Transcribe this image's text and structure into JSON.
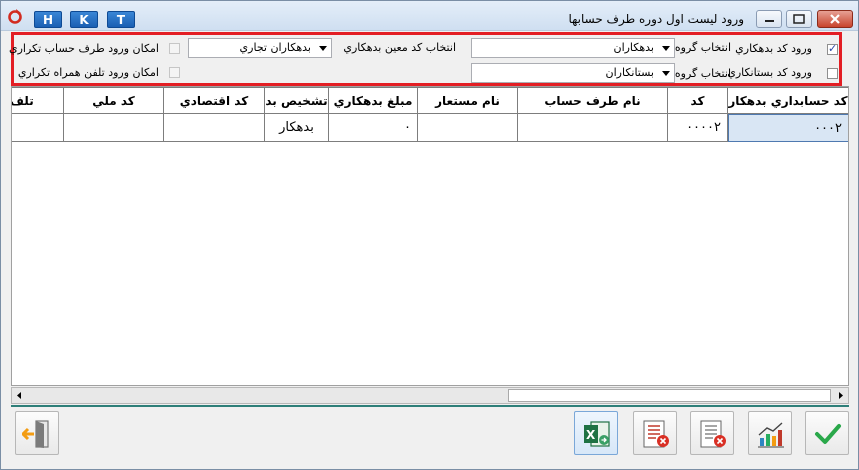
{
  "window": {
    "title": "ورود ليست اول دوره طرف حسابها",
    "hkt": [
      "H",
      "K",
      "T"
    ]
  },
  "filters": {
    "debtor_code_checkbox_label": "ورود کد بدهکاري",
    "debtor_code_checked": true,
    "creditor_code_checkbox_label": "ورود کد بستانکاري",
    "creditor_code_checked": false,
    "group_label_1": "انتخاب گروه",
    "group_value_1": "بدهکاران",
    "group_label_2": "انتخاب گروه",
    "group_value_2": "بستانکاران",
    "specific_code_label": "انتخاب کد معين بدهکاري",
    "specific_code_value": "بدهکاران تجاري",
    "duplicate_account_label": "امکان ورود طرف حساب تکراري",
    "duplicate_phone_label": "امکان ورود تلفن همراه تکراري"
  },
  "grid": {
    "columns": [
      "کد حسابداري بدهکار",
      "کد",
      "نام طرف حساب",
      "نام مستعار",
      "مبلغ بدهکاري",
      "تشخيص بد",
      "کد اقتصادي",
      "کد ملي",
      "تلف"
    ],
    "rows": [
      [
        "۰۰۰۲",
        "۰۰۰۰۲",
        "",
        "",
        "۰",
        "بدهکار",
        "",
        "",
        ""
      ]
    ]
  },
  "buttons": {
    "confirm": "check-icon",
    "chart": "bar-chart-icon",
    "delete_list_1": "delete-list-icon",
    "delete_list_2": "delete-list-icon",
    "excel": "excel-icon",
    "exit": "exit-icon"
  },
  "colors": {
    "filter_border": "#e31e24",
    "separator": "#2e7f79",
    "hkt_blue": "#1a5fb3"
  }
}
